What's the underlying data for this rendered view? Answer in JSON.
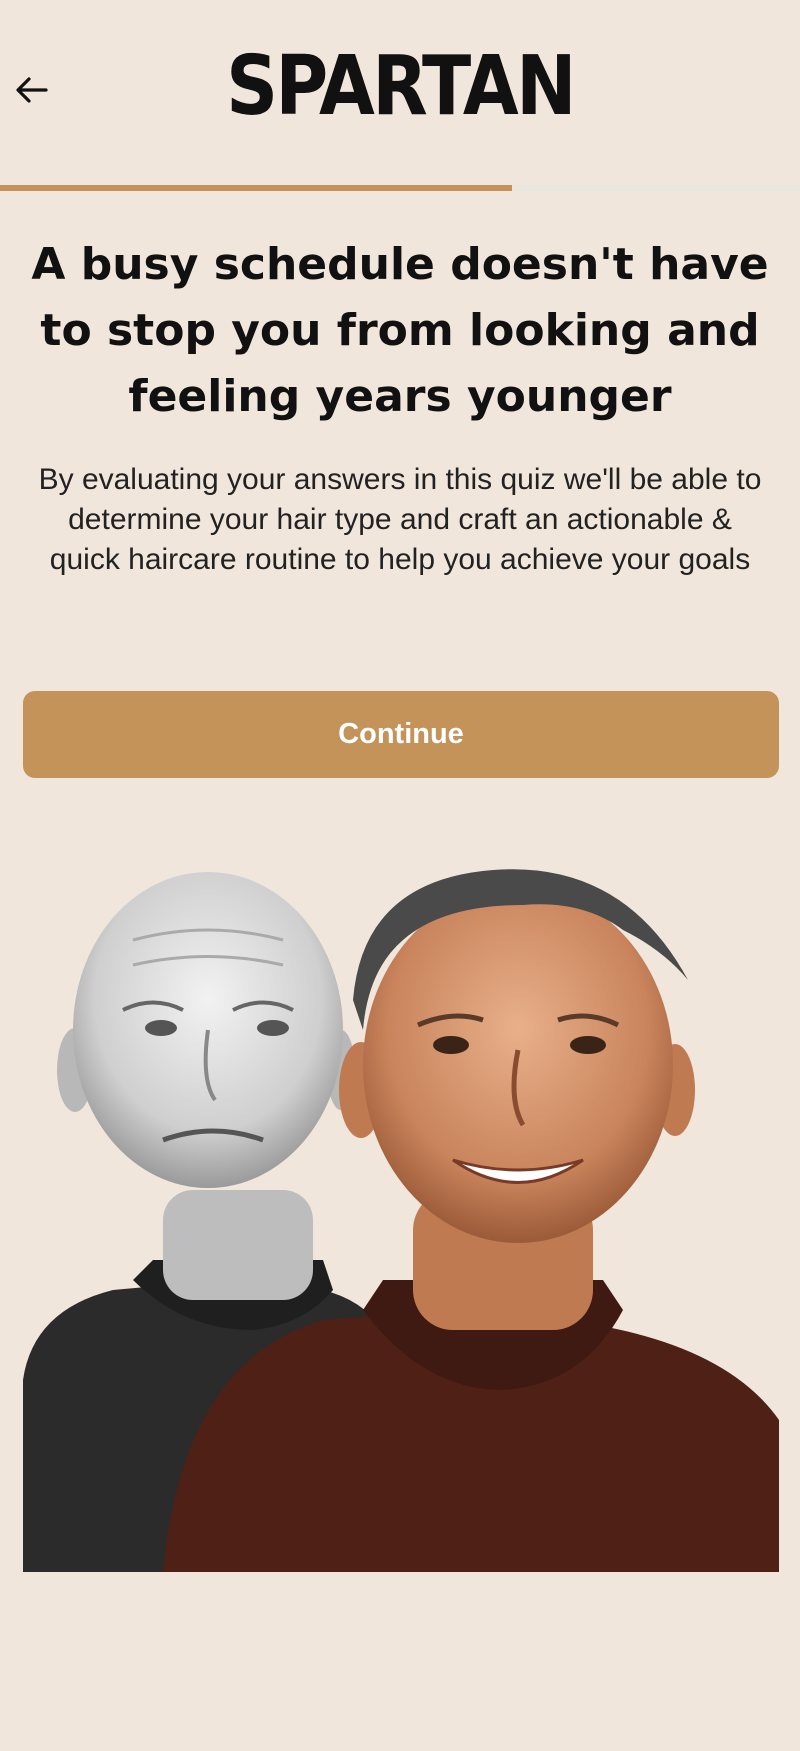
{
  "header": {
    "back_icon": "arrow-left-icon",
    "logo": "SPARTAN"
  },
  "progress": {
    "fraction": 0.64,
    "fill_color": "#c4935a",
    "track_color": "#e7e7df"
  },
  "main": {
    "headline": "A busy schedule doesn't have to stop you from looking and feeling years younger",
    "description": "By evaluating your answers in this quiz we'll be able to determine your hair type and craft an actionable & quick haircare routine to help you achieve your goals",
    "continue_label": "Continue"
  },
  "colors": {
    "background": "#f1e6db",
    "accent": "#c4935a",
    "text": "#111111"
  }
}
